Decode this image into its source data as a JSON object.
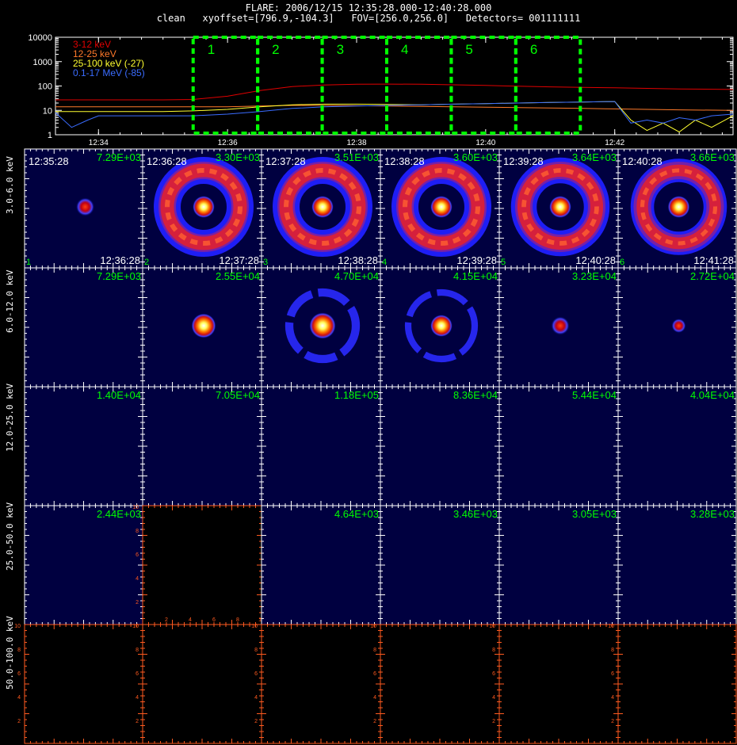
{
  "header": {
    "title": "FLARE: 2006/12/15 12:35:28.000-12:40:28.000",
    "subtitle": "clean   xyoffset=[796.9,-104.3]   FOV=[256.0,256.0]   Detectors= 001111111"
  },
  "chart_data": [
    {
      "type": "line",
      "yscale": "log",
      "ylim": [
        1,
        10000
      ],
      "xlim_minutes": [
        "12:33:20",
        "12:43:50"
      ],
      "y_tick_labels": [
        "1",
        "10",
        "100",
        "1000",
        "10000"
      ],
      "x_tick_labels": [
        "12:34",
        "12:36",
        "12:38",
        "12:40",
        "12:42"
      ],
      "legend": [
        {
          "label": "3-12 keV",
          "color": "#e00000"
        },
        {
          "label": "12-25 keV",
          "color": "#ff7a2a"
        },
        {
          "label": "25-100 keV (-27)",
          "color": "#ffff30"
        },
        {
          "label": "0.1-17 MeV (-85)",
          "color": "#3a6cff"
        }
      ],
      "series": [
        {
          "name": "3-12 keV",
          "color": "#e00000",
          "x": [
            "12:33:20",
            "12:34:00",
            "12:35:00",
            "12:35:28",
            "12:36:00",
            "12:36:30",
            "12:37:00",
            "12:37:30",
            "12:38:00",
            "12:38:30",
            "12:39:00",
            "12:39:30",
            "12:40:00",
            "12:40:30",
            "12:41:00",
            "12:41:30",
            "12:42:00",
            "12:42:30",
            "12:43:00",
            "12:43:50"
          ],
          "y": [
            27,
            27,
            27,
            28,
            38,
            65,
            95,
            110,
            118,
            120,
            118,
            112,
            105,
            98,
            92,
            88,
            84,
            80,
            76,
            72
          ]
        },
        {
          "name": "12-25 keV",
          "color": "#ff7a2a",
          "x": [
            "12:33:20",
            "12:34:00",
            "12:35:00",
            "12:35:28",
            "12:36:00",
            "12:36:30",
            "12:37:00",
            "12:37:30",
            "12:38:00",
            "12:38:30",
            "12:39:00",
            "12:39:30",
            "12:40:00",
            "12:40:30",
            "12:41:00",
            "12:41:30",
            "12:42:00",
            "12:42:30",
            "12:43:00",
            "12:43:50"
          ],
          "y": [
            14,
            14,
            14,
            14,
            14,
            15,
            16,
            16,
            15.5,
            15,
            14.5,
            14,
            13.5,
            13,
            12.5,
            12,
            11.5,
            11,
            10.5,
            10
          ]
        },
        {
          "name": "25-100 keV (-27)",
          "color": "#ffff30",
          "x": [
            "12:33:20",
            "12:34:00",
            "12:35:00",
            "12:35:28",
            "12:36:00",
            "12:36:30",
            "12:37:00",
            "12:37:30",
            "12:38:00",
            "12:38:30",
            "12:39:00",
            "12:39:30",
            "12:40:00",
            "12:40:30",
            "12:41:00",
            "12:41:30",
            "12:42:00",
            "12:42:15",
            "12:42:30",
            "12:42:45",
            "12:43:00",
            "12:43:15",
            "12:43:30",
            "12:43:50"
          ],
          "y": [
            9,
            9,
            9,
            9.5,
            11,
            14,
            17,
            18,
            18,
            17.5,
            17,
            18,
            19,
            20,
            21,
            22,
            23,
            4,
            1.5,
            3,
            1.3,
            4,
            2,
            6
          ]
        },
        {
          "name": "0.1-17 MeV (-85)",
          "color": "#3a6cff",
          "x": [
            "12:33:20",
            "12:33:35",
            "12:33:50",
            "12:34:00",
            "12:35:00",
            "12:35:28",
            "12:36:00",
            "12:36:30",
            "12:37:00",
            "12:37:30",
            "12:38:00",
            "12:38:30",
            "12:39:00",
            "12:39:30",
            "12:40:00",
            "12:40:30",
            "12:41:00",
            "12:41:30",
            "12:42:00",
            "12:42:15",
            "12:42:30",
            "12:42:45",
            "12:43:00",
            "12:43:15",
            "12:43:30",
            "12:43:50"
          ],
          "y": [
            8,
            2,
            4,
            6,
            6,
            6,
            7,
            9,
            12,
            14,
            15,
            16,
            17,
            18,
            19,
            20,
            21,
            22,
            23,
            3,
            4,
            3,
            5,
            4,
            6,
            7
          ]
        }
      ],
      "intervals": [
        {
          "label": "1",
          "start": "12:35:28",
          "end": "12:36:28"
        },
        {
          "label": "2",
          "start": "12:36:28",
          "end": "12:37:28"
        },
        {
          "label": "3",
          "start": "12:37:28",
          "end": "12:38:28"
        },
        {
          "label": "4",
          "start": "12:38:28",
          "end": "12:39:28"
        },
        {
          "label": "5",
          "start": "12:39:28",
          "end": "12:40:28"
        },
        {
          "label": "6",
          "start": "12:40:28",
          "end": "12:41:28"
        }
      ]
    },
    {
      "type": "heatmap",
      "rows": [
        "3.0-6.0 keV",
        "6.0-12.0 keV",
        "12.0-25.0 keV",
        "25.0-50.0 keV",
        "50.0-100.0 keV"
      ],
      "columns": [
        {
          "start": "12:35:28",
          "end": "12:36:28",
          "index": "1"
        },
        {
          "start": "12:36:28",
          "end": "12:37:28",
          "index": "2"
        },
        {
          "start": "12:37:28",
          "end": "12:38:28",
          "index": "3"
        },
        {
          "start": "12:38:28",
          "end": "12:39:28",
          "index": "4"
        },
        {
          "start": "12:39:28",
          "end": "12:40:28",
          "index": "5"
        },
        {
          "start": "12:40:28",
          "end": "12:41:28",
          "index": "6"
        }
      ],
      "max_values": [
        [
          "7.29E+03",
          "3.30E+03",
          "3.51E+03",
          "3.60E+03",
          "3.64E+03",
          "3.66E+03"
        ],
        [
          "7.29E+03",
          "2.55E+04",
          "4.70E+04",
          "4.15E+04",
          "3.23E+04",
          "2.72E+04"
        ],
        [
          "1.40E+04",
          "7.05E+04",
          "1.18E+05",
          "8.36E+04",
          "5.44E+04",
          "4.04E+04"
        ],
        [
          "2.44E+03",
          "",
          "4.64E+03",
          "3.46E+03",
          "3.05E+03",
          "3.28E+03"
        ],
        [
          "",
          "",
          "",
          "",
          "",
          ""
        ]
      ],
      "images": [
        [
          {
            "kind": "spot",
            "size": 0.9
          },
          {
            "kind": "ring",
            "ring": 1.0,
            "core": 1.0
          },
          {
            "kind": "ring",
            "ring": 1.0,
            "core": 1.0
          },
          {
            "kind": "ring",
            "ring": 1.0,
            "core": 1.0
          },
          {
            "kind": "ring",
            "ring": 0.95,
            "core": 1.0
          },
          {
            "kind": "ring",
            "ring": 0.85,
            "core": 1.0
          }
        ],
        [
          {
            "kind": "none"
          },
          {
            "kind": "spot",
            "size": 1.2
          },
          {
            "kind": "ring",
            "ring": 0.45,
            "core": 1.2
          },
          {
            "kind": "ring",
            "ring": 0.3,
            "core": 1.0
          },
          {
            "kind": "spot",
            "size": 0.9
          },
          {
            "kind": "spot",
            "size": 0.7
          }
        ],
        [
          {
            "kind": "none"
          },
          {
            "kind": "none"
          },
          {
            "kind": "none"
          },
          {
            "kind": "none"
          },
          {
            "kind": "none"
          },
          {
            "kind": "none"
          }
        ],
        [
          {
            "kind": "none"
          },
          {
            "kind": "empty"
          },
          {
            "kind": "none"
          },
          {
            "kind": "none"
          },
          {
            "kind": "none"
          },
          {
            "kind": "none"
          }
        ],
        [
          {
            "kind": "empty"
          },
          {
            "kind": "empty"
          },
          {
            "kind": "empty"
          },
          {
            "kind": "empty"
          },
          {
            "kind": "empty"
          },
          {
            "kind": "empty"
          }
        ]
      ],
      "empty_axis_ticks": [
        "2",
        "4",
        "6",
        "8",
        "10"
      ]
    }
  ],
  "colors": {
    "panel_bg": "#000040",
    "cell_border": "#ffffff",
    "grid_accent": "#00ff00",
    "empty_axis": "#ff5a1f"
  }
}
